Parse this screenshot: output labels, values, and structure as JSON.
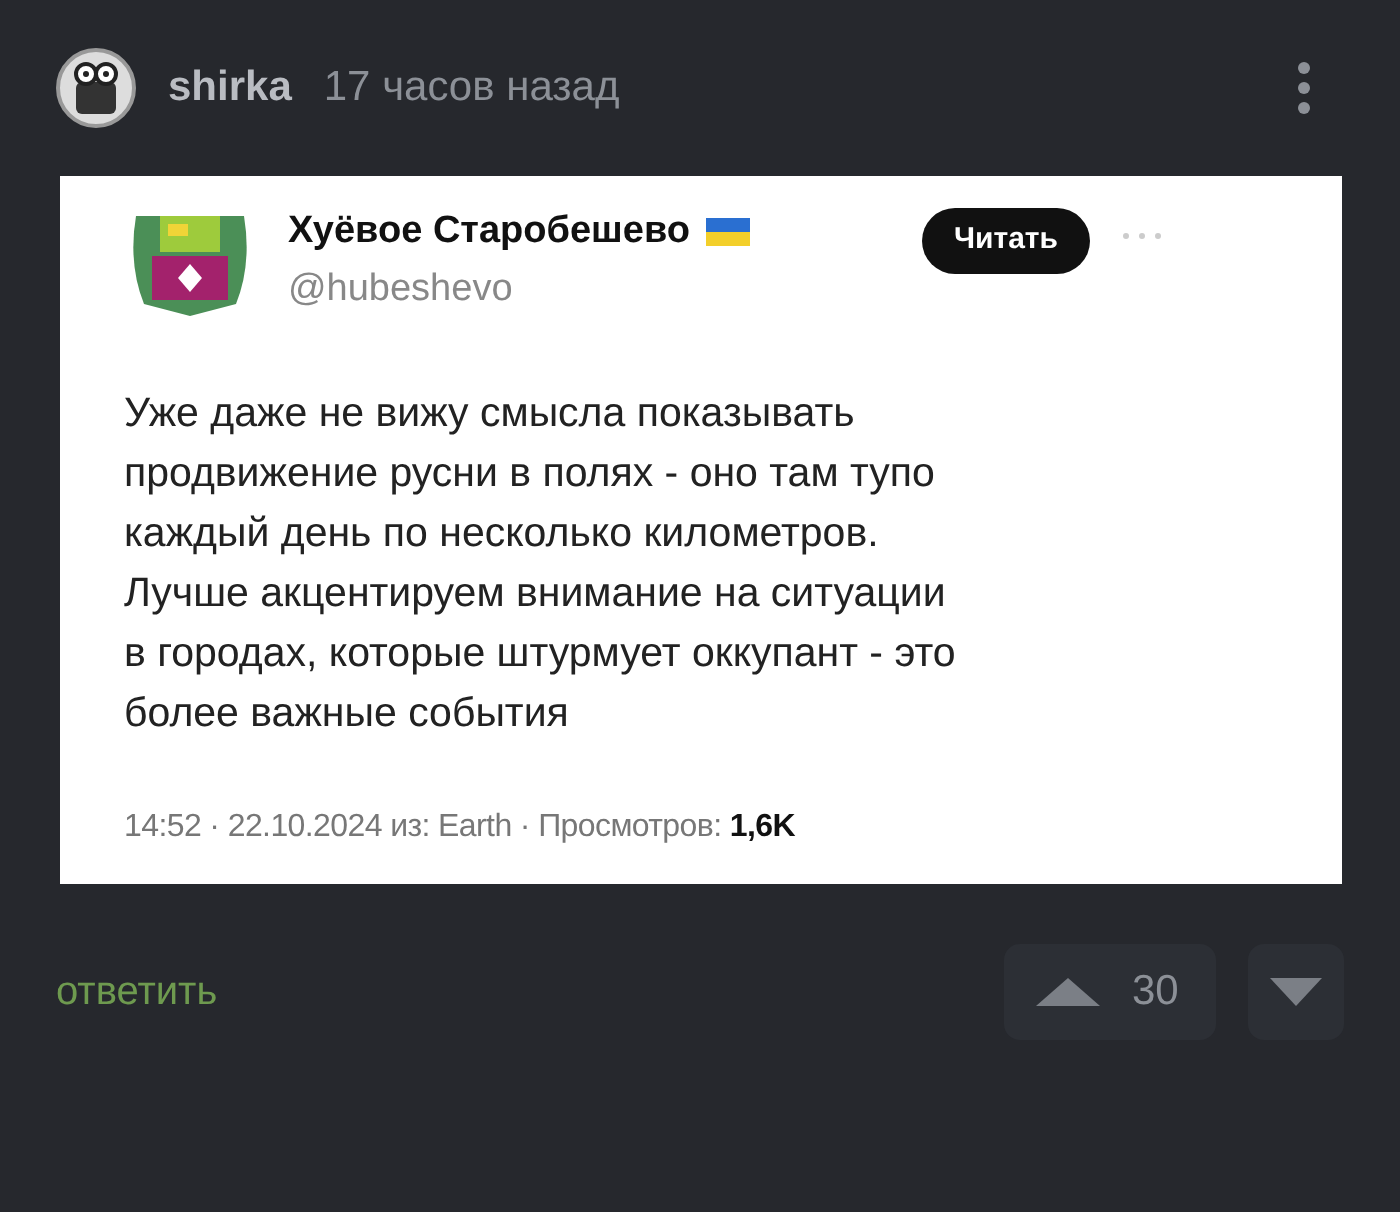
{
  "comment": {
    "author": "shirka",
    "time": "17 часов назад",
    "embedded_post": {
      "account_name": "Хуёвое Старобешево",
      "handle": "@hubeshevo",
      "follow_button": "Читать",
      "text": "Уже даже не вижу смысла показывать продвижение русни в полях - оно там тупо каждый день по несколько километров. Лучше акцентируем внимание на ситуации в городах, которые штурмует оккупант - это более важные события",
      "meta": "14:52 · 22.10.2024 из: Earth · Просмотров: **1,6K**"
    },
    "reply_link": "ответить",
    "rating": "30"
  }
}
